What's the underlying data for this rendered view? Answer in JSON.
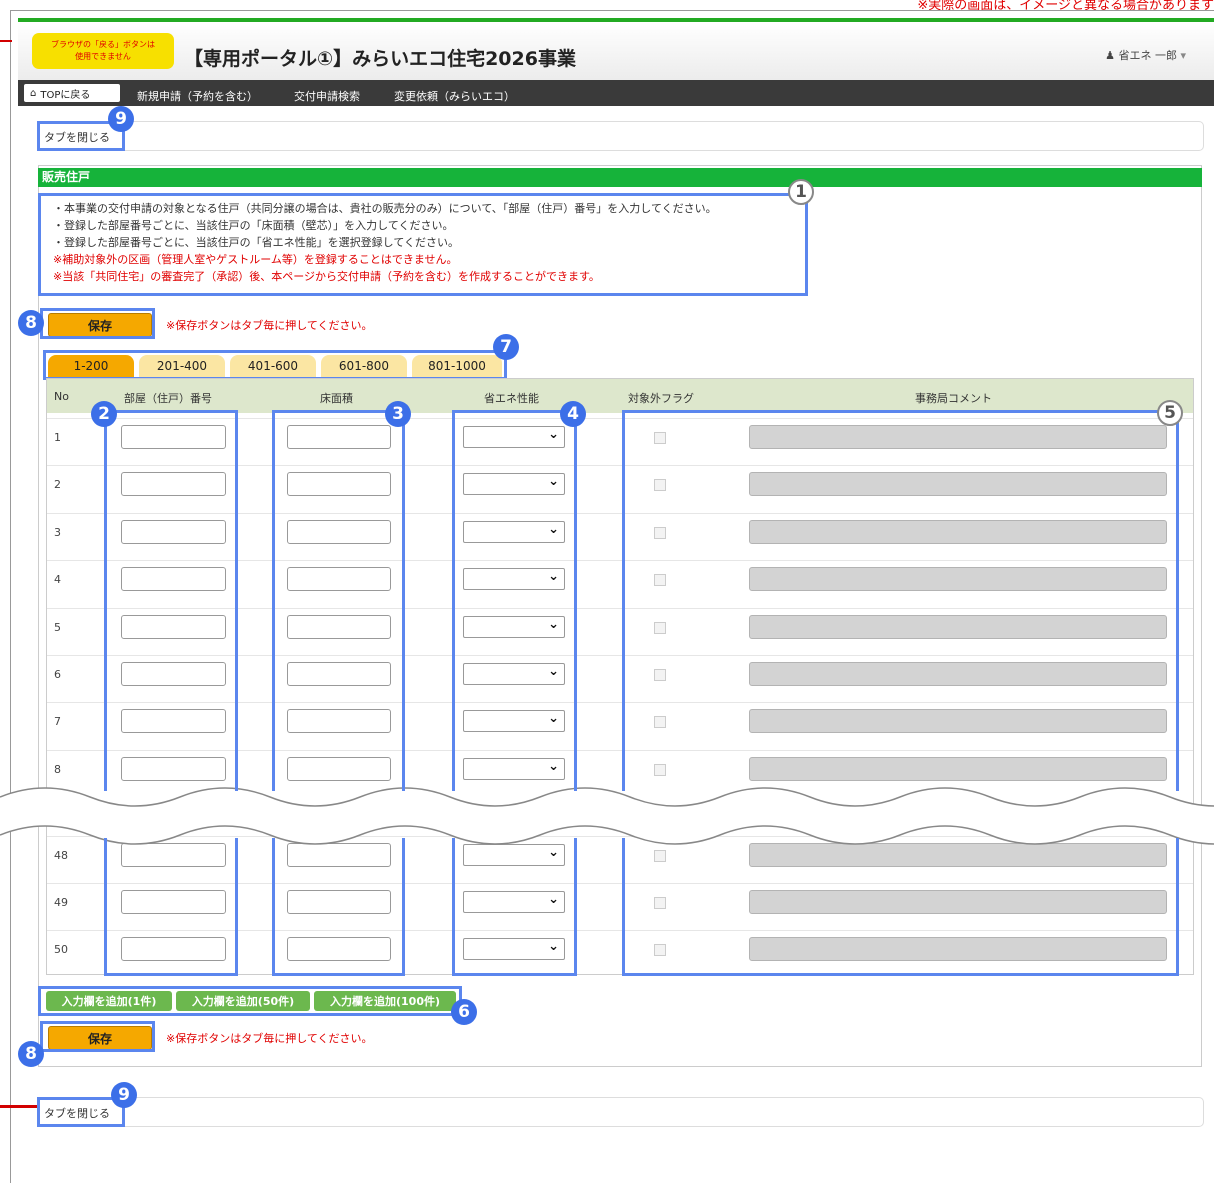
{
  "top_note": "※実際の画面は、イメージと異なる場合があります",
  "header": {
    "back_note_line1": "ブラウザの「戻る」ボタンは",
    "back_note_line2": "使用できません",
    "title": "【専用ポータル①】みらいエコ住宅2026事業",
    "user": "省エネ 一郎"
  },
  "nav": {
    "home": "TOPに戻る",
    "links": [
      "新規申請（予約を含む）",
      "交付申請検索",
      "変更依頼（みらいエコ）"
    ]
  },
  "tab_close_label": "タブを閉じる",
  "section": {
    "title": "販売住戸",
    "instructions": [
      "・本事業の交付申請の対象となる住戸（共同分譲の場合は、貴社の販売分のみ）について、「部屋（住戸）番号」を入力してください。",
      "・登録した部屋番号ごとに、当該住戸の「床面積（壁芯）」を入力してください。",
      "・登録した部屋番号ごとに、当該住戸の「省エネ性能」を選択登録してください。"
    ],
    "warnings": [
      "※補助対象外の区画（管理人室やゲストルーム等）を登録することはできません。",
      "※当該「共同住宅」の審査完了（承認）後、本ページから交付申請（予約を含む）を作成することができます。"
    ]
  },
  "save": {
    "label": "保存",
    "note": "※保存ボタンはタブ毎に押してください。"
  },
  "tabs": [
    "1-200",
    "201-400",
    "401-600",
    "601-800",
    "801-1000"
  ],
  "active_tab": "1-200",
  "table": {
    "headers": [
      "No",
      "部屋（住戸）番号",
      "床面積",
      "省エネ性能",
      "対象外フラグ",
      "事務局コメント"
    ],
    "rows_top": [
      "1",
      "2",
      "3",
      "4",
      "5",
      "6",
      "7",
      "8"
    ],
    "rows_bottom": [
      "48",
      "49",
      "50"
    ]
  },
  "add_buttons": [
    "入力欄を追加(1件)",
    "入力欄を追加(50件)",
    "入力欄を追加(100件)"
  ],
  "badges": {
    "b1": "1",
    "b2": "2",
    "b3": "3",
    "b4": "4",
    "b5": "5",
    "b6": "6",
    "b7": "7",
    "b8": "8",
    "b9": "9"
  },
  "colors": {
    "section_green": "#16b33a",
    "save_orange": "#f5a800",
    "highlight_blue": "#5b86ee",
    "badge_blue": "#3c6fe8",
    "warning_red": "#e00000",
    "add_green": "#6cb84e"
  }
}
